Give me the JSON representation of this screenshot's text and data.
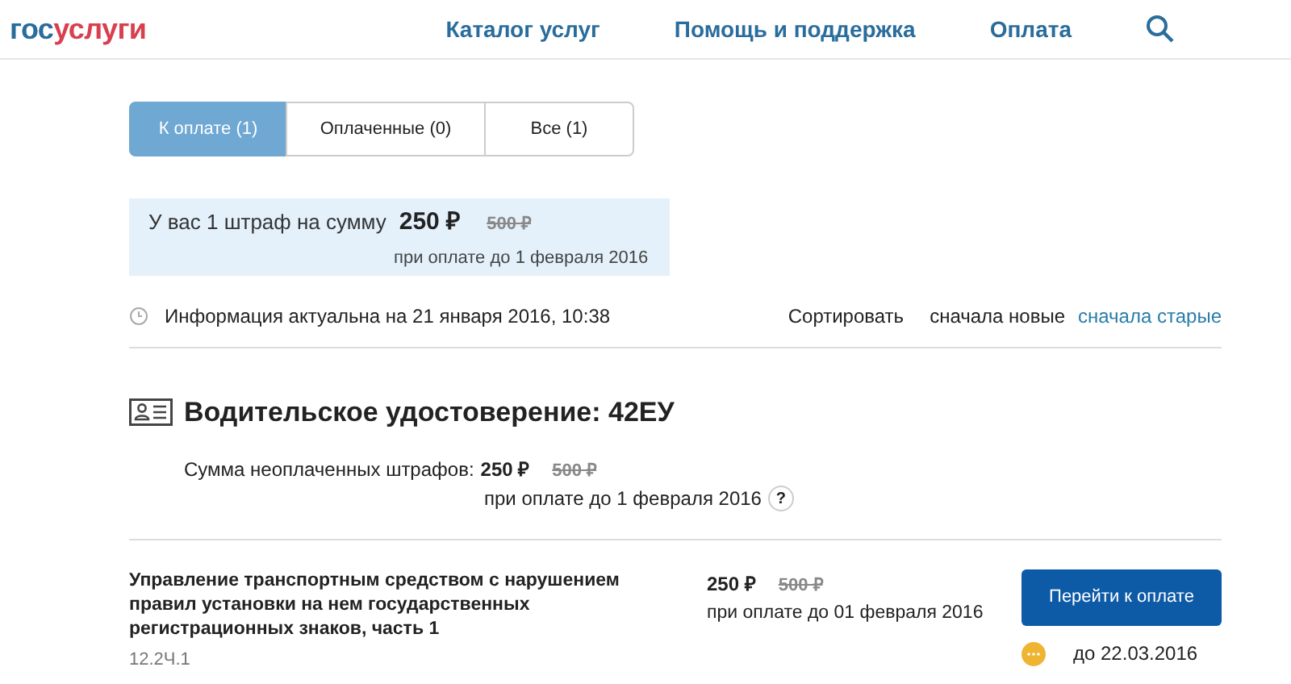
{
  "header": {
    "logo": {
      "part_1": "гос",
      "part_2": "услуги"
    },
    "nav": [
      "Каталог услуг",
      "Помощь и поддержка",
      "Оплата"
    ]
  },
  "tabs": [
    {
      "label": "К оплате (1)",
      "selected": true
    },
    {
      "label": "Оплаченные (0)",
      "selected": false
    },
    {
      "label": "Все (1)",
      "selected": false
    }
  ],
  "summary": {
    "text": "У вас 1 штраф на сумму",
    "amount": "250 ₽",
    "old_amount": "500 ₽",
    "deadline": "при оплате до 1 февраля 2016"
  },
  "info": "Информация актуальна на 21 января 2016, 10:38",
  "sort": {
    "label": "Сортировать",
    "options": [
      {
        "label": "сначала новые",
        "selected": true
      },
      {
        "label": "сначала старые",
        "selected": false
      }
    ]
  },
  "document": {
    "title": "Водительское удостоверение: 42ЕУ",
    "sum_label": "Сумма неоплаченных штрафов:",
    "amount": "250 ₽",
    "old_amount": "500 ₽",
    "deadline": "при оплате до 1 февраля 2016",
    "help": "?"
  },
  "fines": [
    {
      "title": "Управление транспортным средством с нарушением правил установки на нем государственных регистрационных знаков, часть 1",
      "article": "12.2Ч.1",
      "amount": "250 ₽",
      "old_amount": "500 ₽",
      "deadline": "при оплате до 01 февраля 2016",
      "button": "Перейти к оплате",
      "due": "до 22.03.2016"
    }
  ]
}
